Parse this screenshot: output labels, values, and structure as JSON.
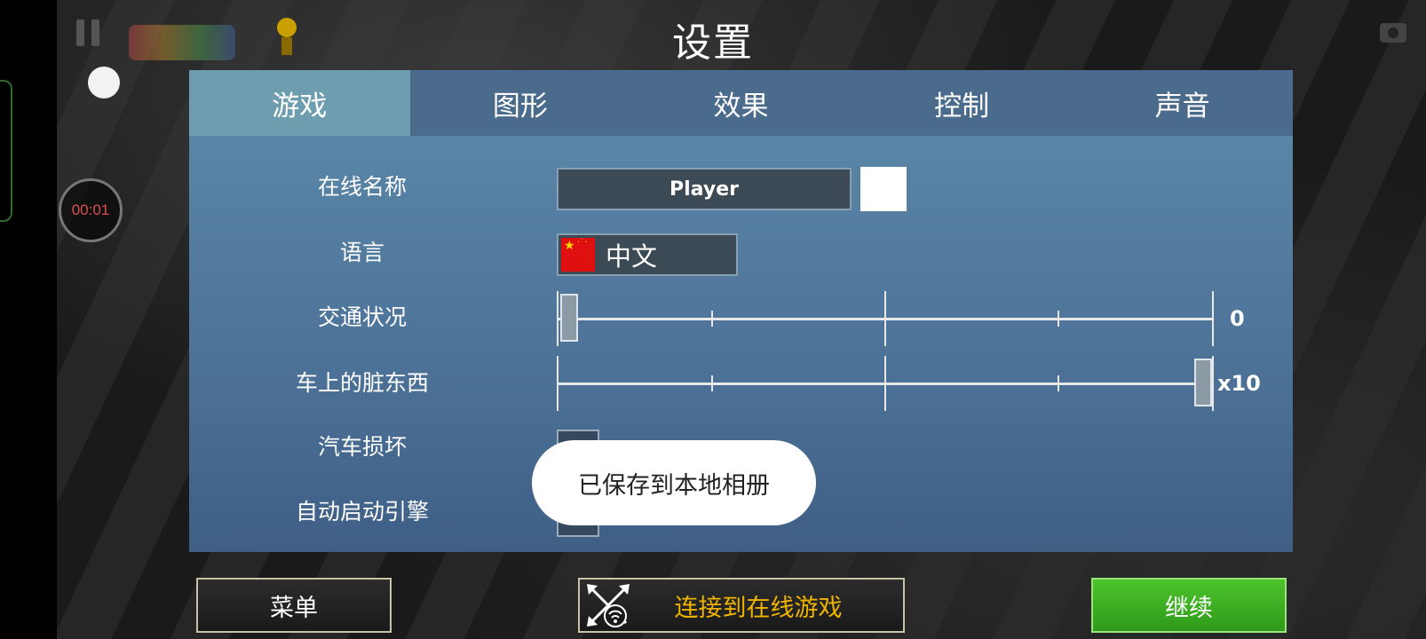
{
  "title": "设置",
  "timer": "00:01",
  "tabs": [
    {
      "label": "游戏",
      "active": true
    },
    {
      "label": "图形",
      "active": false
    },
    {
      "label": "效果",
      "active": false
    },
    {
      "label": "控制",
      "active": false
    },
    {
      "label": "声音",
      "active": false
    }
  ],
  "settings": {
    "online_name": {
      "label": "在线名称",
      "value": "Player",
      "color": "#ffffff"
    },
    "language": {
      "label": "语言",
      "value": "中文"
    },
    "traffic": {
      "label": "交通状况",
      "value": "0",
      "level": 0
    },
    "dirt": {
      "label": "车上的脏东西",
      "value": "x10",
      "level": 1
    },
    "damage": {
      "label": "汽车损坏"
    },
    "auto_start": {
      "label": "自动启动引擎"
    }
  },
  "toast": "已保存到本地相册",
  "buttons": {
    "menu": "菜单",
    "online": "连接到在线游戏",
    "continue": "继续"
  },
  "colors": {
    "accent_online": "#f0b400",
    "continue_green": "#3fb422",
    "panel_blue": "#547da0",
    "active_tab": "#6f9db0"
  }
}
